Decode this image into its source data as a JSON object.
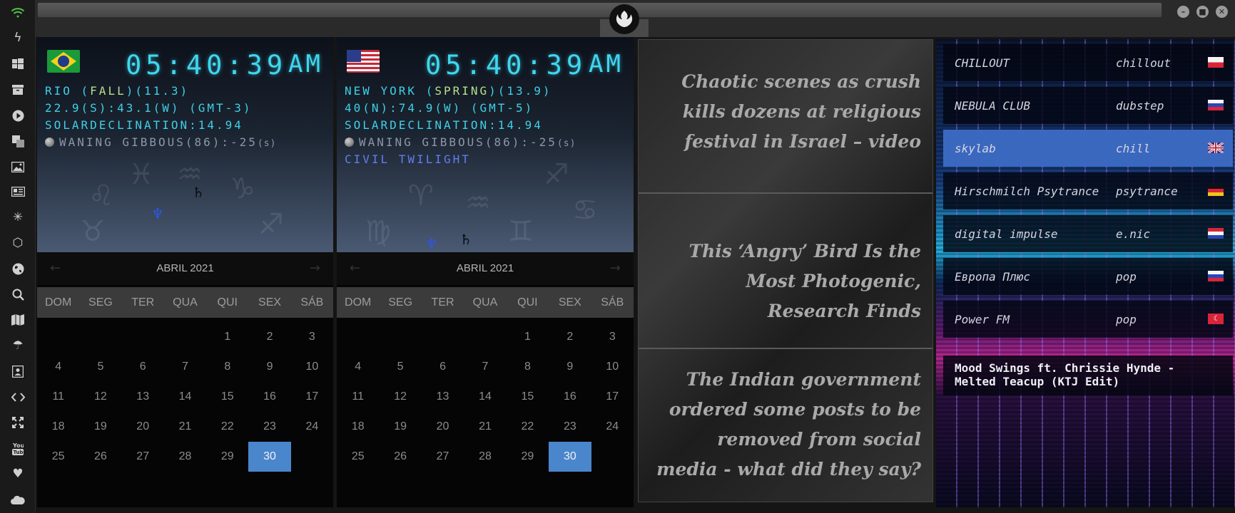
{
  "sidebar": {
    "icons": [
      "wifi-icon",
      "bolt-icon",
      "windows-icon",
      "archive-icon",
      "play-icon",
      "translate-icon",
      "image-icon",
      "news-icon",
      "settings-icon",
      "network-icon",
      "globe-icon",
      "search-icon",
      "map-icon",
      "umbrella-icon",
      "contacts-icon",
      "code-icon",
      "fullscreen-icon",
      "youtube-icon",
      "heart-icon",
      "cloud-icon"
    ]
  },
  "topbar": {
    "window_controls": [
      "minimize",
      "maximize",
      "close"
    ]
  },
  "clocks": [
    {
      "time": "05:40:39",
      "ampm": "AM",
      "city": "RIO",
      "season": "FALL",
      "temp_tag": "(11.3)",
      "coords": "22.9(S):43.1(W) (GMT-3)",
      "solar": "SOLARDECLINATION:14.94",
      "moon": "WANING GIBBOUS(86):-25",
      "moon_suffix": "(s)",
      "extra": "",
      "month": "ABRIL 2021",
      "today": "30"
    },
    {
      "time": "05:40:39",
      "ampm": "AM",
      "city": "NEW YORK",
      "season": "SPRING",
      "temp_tag": "(13.9)",
      "coords": "40(N):74.9(W) (GMT-5)",
      "solar": "SOLARDECLINATION:14.94",
      "moon": "WANING GIBBOUS(86):-25",
      "moon_suffix": "(s)",
      "extra": "CIVIL TWILIGHT",
      "month": "ABRIL 2021",
      "today": "30"
    }
  ],
  "calendar": {
    "weekdays": [
      "DOM",
      "SEG",
      "TER",
      "QUA",
      "QUI",
      "SEX",
      "SÁB"
    ],
    "leading_blanks": 4,
    "days_in_month": 30
  },
  "news": [
    "Chaotic scenes as crush kills dozens at religious festival in Israel – video",
    "This ‘Angry’ Bird Is the Most Photogenic, Research Finds",
    "The Indian government ordered some posts to be removed from social media - what did they say?"
  ],
  "radio": {
    "stations": [
      {
        "name": "CHILLOUT",
        "genre": "chillout",
        "flag": "poland"
      },
      {
        "name": "NEBULA CLUB",
        "genre": "dubstep",
        "flag": "russia"
      },
      {
        "name": "skylab",
        "genre": "chill",
        "flag": "uk"
      },
      {
        "name": "Hirschmilch Psytrance",
        "genre": "psytrance",
        "flag": "germany"
      },
      {
        "name": "digital impulse",
        "genre": "e.nic",
        "flag": "croatia"
      },
      {
        "name": "Европа Плюс",
        "genre": "pop",
        "flag": "russia"
      },
      {
        "name": "Power FM",
        "genre": "pop",
        "flag": "turkey"
      }
    ],
    "now_playing": "Mood Swings ft. Chrissie Hynde - Melted Teacup (KTJ Edit)",
    "active_index": 2
  },
  "colors": {
    "digital": "#40d6ee",
    "today_highlight": "#4a86cc",
    "active_station": "#3b68bf"
  }
}
